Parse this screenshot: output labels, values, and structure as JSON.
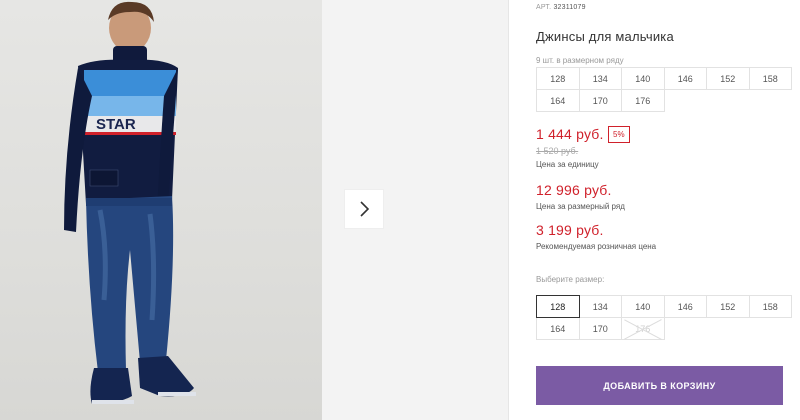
{
  "gallery": {
    "next_icon": "chevron-right-icon",
    "shirt_text": "STAR",
    "accent": "#d0212b"
  },
  "product": {
    "article_label": "АРТ.",
    "article_code": "32311079",
    "title": "Джинсы для мальчика"
  },
  "row_sizes": {
    "label": "9 шт. в размерном ряду",
    "sizes": [
      "128",
      "134",
      "140",
      "146",
      "152",
      "158",
      "164",
      "170",
      "176"
    ]
  },
  "pricing": {
    "unit_price": "1 444 руб.",
    "discount": "5%",
    "old_price": "1 520 руб.",
    "unit_caption": "Цена за единицу",
    "row_price": "12 996 руб.",
    "row_caption": "Цена за размерный ряд",
    "retail_price": "3 199 руб.",
    "retail_caption": "Рекомендуемая розничная цена",
    "price_color": "#d0212b"
  },
  "size_select": {
    "label": "Выберите размер:",
    "sizes": [
      "128",
      "134",
      "140",
      "146",
      "152",
      "158",
      "164",
      "170",
      "176"
    ],
    "selected": "128",
    "unavailable": [
      "176"
    ]
  },
  "cart": {
    "add_label": "ДОБАВИТЬ В КОРЗИНУ",
    "button_color": "#7b5ba4"
  }
}
